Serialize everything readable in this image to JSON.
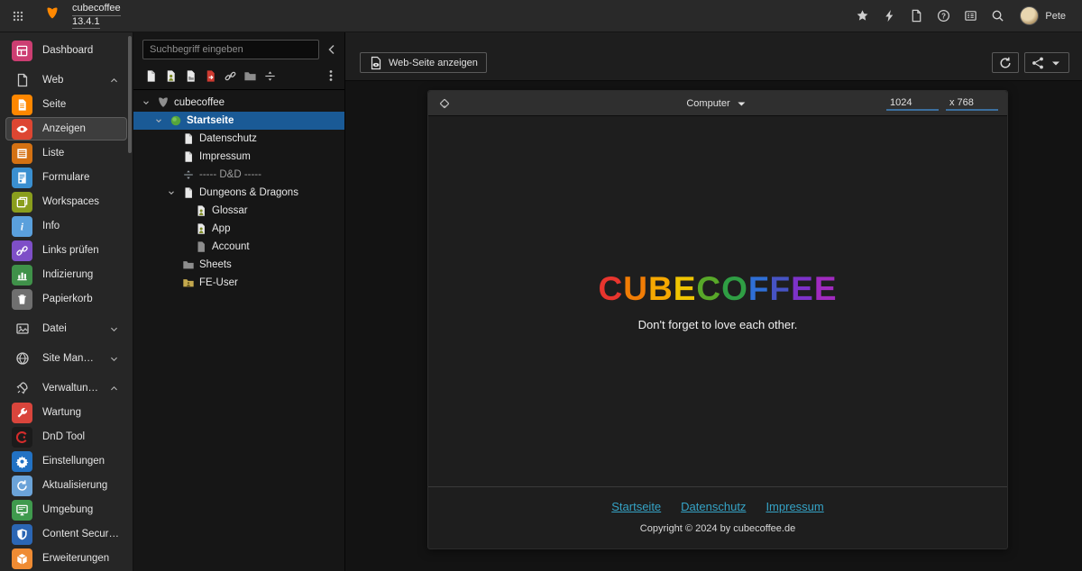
{
  "topbar": {
    "sitename": "cubecoffee",
    "version": "13.4.1",
    "username": "Pete",
    "right_icons": [
      {
        "name": "bookmark-star-icon",
        "icon": "star"
      },
      {
        "name": "clear-cache-icon",
        "icon": "bolt"
      },
      {
        "name": "new-document-icon",
        "icon": "docO"
      },
      {
        "name": "help-icon",
        "icon": "help"
      },
      {
        "name": "system-information-icon",
        "icon": "listbox"
      },
      {
        "name": "search-icon",
        "icon": "search"
      }
    ]
  },
  "sidebar": {
    "items": [
      {
        "id": "dashboard",
        "label": "Dashboard",
        "kind": "module",
        "icon": "dashboard",
        "color": "#cc3e72"
      },
      {
        "id": "web",
        "label": "Web",
        "kind": "group",
        "icon": "docO",
        "chevron": "up"
      },
      {
        "id": "seite",
        "label": "Seite",
        "kind": "module",
        "icon": "page",
        "color": "#ff8700"
      },
      {
        "id": "anzeigen",
        "label": "Anzeigen",
        "kind": "module",
        "icon": "eye",
        "color": "#dd4632",
        "active": true
      },
      {
        "id": "liste",
        "label": "Liste",
        "kind": "module",
        "icon": "lines",
        "color": "#d47113"
      },
      {
        "id": "formulare",
        "label": "Formulare",
        "kind": "module",
        "icon": "form",
        "color": "#3a8fd0"
      },
      {
        "id": "workspaces",
        "label": "Workspaces",
        "kind": "module",
        "icon": "layers",
        "color": "#8a9e1d"
      },
      {
        "id": "info",
        "label": "Info",
        "kind": "module",
        "icon": "info",
        "color": "#5aa0dc"
      },
      {
        "id": "links-pruefen",
        "label": "Links prüfen",
        "kind": "module",
        "icon": "linkpen",
        "color": "#7e4fc7"
      },
      {
        "id": "indizierung",
        "label": "Indizierung",
        "kind": "module",
        "icon": "chart",
        "color": "#3f9149"
      },
      {
        "id": "papierkorb",
        "label": "Papierkorb",
        "kind": "module",
        "icon": "trash",
        "color": "#6f6f6f"
      },
      {
        "id": "datei",
        "label": "Datei",
        "kind": "group",
        "icon": "image",
        "chevron": "down"
      },
      {
        "id": "site-management",
        "label": "Site Management",
        "kind": "group",
        "icon": "globe",
        "chevron": "down"
      },
      {
        "id": "verwaltungswerkzeuge",
        "label": "Verwaltungswerkz...",
        "kind": "group",
        "icon": "rocket",
        "chevron": "up"
      },
      {
        "id": "wartung",
        "label": "Wartung",
        "kind": "module",
        "icon": "wrench",
        "color": "#d9453c"
      },
      {
        "id": "dnd-tool",
        "label": "DnD Tool",
        "kind": "module",
        "icon": "dndC",
        "color": "#1b1b1b"
      },
      {
        "id": "einstellungen",
        "label": "Einstellungen",
        "kind": "module",
        "icon": "gear",
        "color": "#2272c4"
      },
      {
        "id": "aktualisierung",
        "label": "Aktualisierung",
        "kind": "module",
        "icon": "refresh",
        "color": "#6ba3d8"
      },
      {
        "id": "umgebung",
        "label": "Umgebung",
        "kind": "module",
        "icon": "monitor",
        "color": "#3f9a4d"
      },
      {
        "id": "content-security-policy",
        "label": "Content Security Policy",
        "kind": "module",
        "icon": "shield",
        "color": "#2b66b4"
      },
      {
        "id": "erweiterungen",
        "label": "Erweiterungen",
        "kind": "module",
        "icon": "cube",
        "color": "#ef8b33"
      }
    ]
  },
  "pagetree": {
    "search_placeholder": "Suchbegriff eingeben",
    "toolbar_icons": [
      {
        "name": "new-page-icon",
        "icon": "pageW"
      },
      {
        "name": "new-shortcut-page-icon",
        "icon": "pageFe"
      },
      {
        "name": "new-mountpoint-page-icon",
        "icon": "pageMount"
      },
      {
        "name": "new-external-link-page-icon",
        "icon": "pageRed"
      },
      {
        "name": "new-link-icon",
        "icon": "link"
      },
      {
        "name": "new-folder-icon",
        "icon": "folderG"
      },
      {
        "name": "new-spacer-icon",
        "icon": "spacer"
      }
    ],
    "nodes": [
      {
        "label": "cubecoffee",
        "icon": "typo3gray",
        "level": 0,
        "chevron": true
      },
      {
        "label": "Startseite",
        "icon": "globeGreen",
        "level": 1,
        "chevron": true,
        "selected": true
      },
      {
        "label": "Datenschutz",
        "icon": "pageW",
        "level": 2
      },
      {
        "label": "Impressum",
        "icon": "pageW",
        "level": 2
      },
      {
        "label": "----- D&D -----",
        "icon": "spacer",
        "level": 2,
        "muted": true
      },
      {
        "label": "Dungeons & Dragons",
        "icon": "pageW",
        "level": 2,
        "chevron": true
      },
      {
        "label": "Glossar",
        "icon": "pageFe",
        "level": 3
      },
      {
        "label": "App",
        "icon": "pageFe",
        "level": 3
      },
      {
        "label": "Account",
        "icon": "pageGray",
        "level": 3
      },
      {
        "label": "Sheets",
        "icon": "folderG",
        "level": 2
      },
      {
        "label": "FE-User",
        "icon": "folderU",
        "level": 2
      }
    ]
  },
  "docheader": {
    "view_page_label": "Web-Seite anzeigen"
  },
  "preview": {
    "device_label": "Computer",
    "width_value": "1024",
    "height_value": "x 768",
    "logo_letters": [
      {
        "ch": "C",
        "color": "#e8352e"
      },
      {
        "ch": "U",
        "color": "#f07c05"
      },
      {
        "ch": "B",
        "color": "#f5a802"
      },
      {
        "ch": "E",
        "color": "#efc402"
      },
      {
        "ch": "C",
        "color": "#58a829"
      },
      {
        "ch": "O",
        "color": "#2f9e44"
      },
      {
        "ch": "F",
        "color": "#2f6fd6"
      },
      {
        "ch": "F",
        "color": "#4653c4"
      },
      {
        "ch": "E",
        "color": "#7d32c9"
      },
      {
        "ch": "E",
        "color": "#a12bbf"
      }
    ],
    "tagline": "Don't forget to love each other.",
    "footer_links": [
      "Startseite",
      "Datenschutz",
      "Impressum"
    ],
    "copyright": "Copyright © 2024 by cubecoffee.de"
  }
}
